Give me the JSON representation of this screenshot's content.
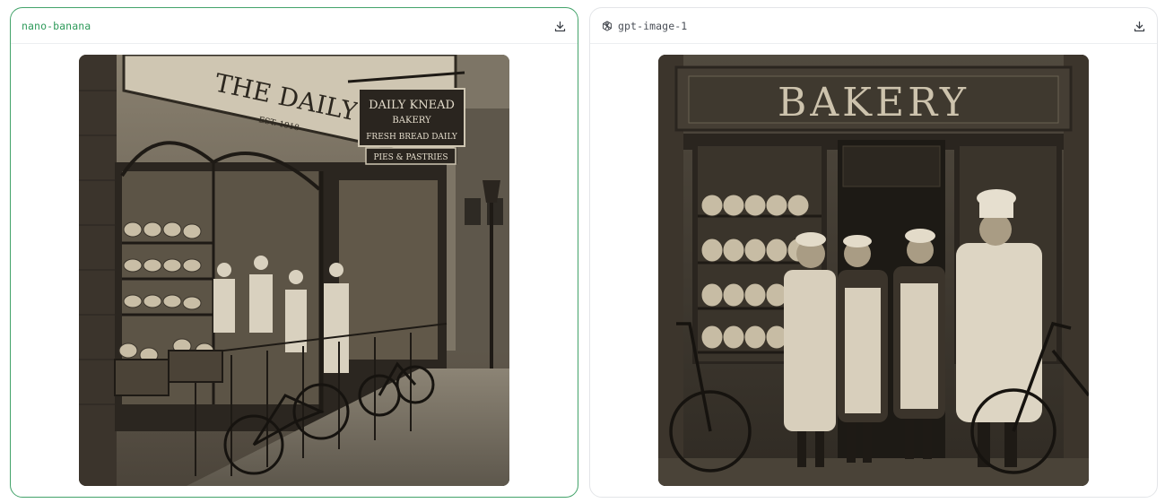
{
  "cards": [
    {
      "model": "nano-banana",
      "selected": true,
      "image": {
        "storefront_sign": "THE DAILY KNEAD",
        "storefront_est": "EST. 1918",
        "hanging_sign_line1": "DAILY KNEAD",
        "hanging_sign_line2": "BAKERY",
        "hanging_sign_line3": "FRESH BREAD DAILY",
        "hanging_sign_line4": "PIES & PASTRIES"
      }
    },
    {
      "model": "gpt-image-1",
      "selected": false,
      "image": {
        "storefront_sign": "BAKERY"
      }
    }
  ],
  "icons": {
    "download": "download-icon",
    "provider": "openai-icon"
  },
  "colors": {
    "selected_border": "#43a36a",
    "selected_label": "#2e9a5a",
    "default_border": "#e3e5e8"
  }
}
